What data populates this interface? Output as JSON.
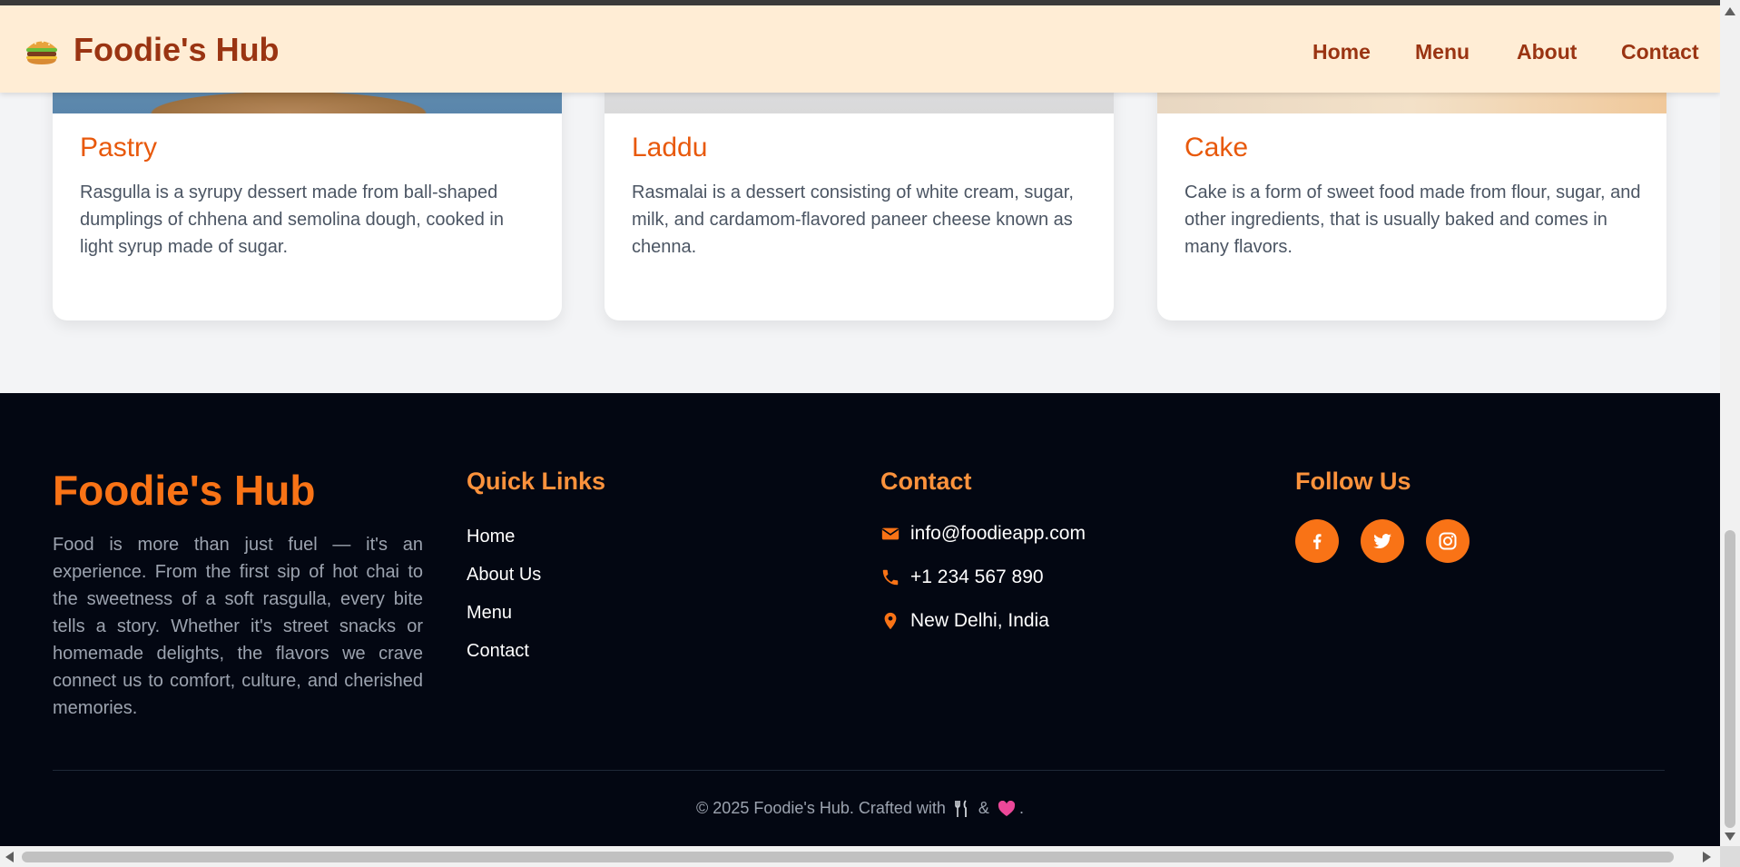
{
  "header": {
    "logo_icon": "burger-emoji-icon",
    "brand": "Foodie's Hub",
    "nav": [
      "Home",
      "Menu",
      "About",
      "Contact"
    ]
  },
  "cards": [
    {
      "title": "Pastry",
      "description": "Rasgulla is a syrupy dessert made from ball-shaped dumplings of chhena and semolina dough, cooked in light syrup made of sugar."
    },
    {
      "title": "Laddu",
      "description": "Rasmalai is a dessert consisting of white cream, sugar, milk, and cardamom-flavored paneer cheese known as chenna."
    },
    {
      "title": "Cake",
      "description": "Cake is a form of sweet food made from flour, sugar, and other ingredients, that is usually baked and comes in many flavors."
    }
  ],
  "footer": {
    "brand": "Foodie's Hub",
    "about": "Food is more than just fuel — it's an experience. From the first sip of hot chai to the sweetness of a soft rasgulla, every bite tells a story. Whether it's street snacks or homemade delights, the flavors we crave connect us to comfort, culture, and cherished memories.",
    "quick_links_heading": "Quick Links",
    "quick_links": [
      "Home",
      "About Us",
      "Menu",
      "Contact"
    ],
    "contact_heading": "Contact",
    "contact": {
      "email": "info@foodieapp.com",
      "phone": "+1 234 567 890",
      "location": "New Delhi, India"
    },
    "follow_heading": "Follow Us",
    "social": [
      "facebook-icon",
      "twitter-icon",
      "instagram-icon"
    ],
    "copyright_prefix": "© 2025 Foodie's Hub. Crafted with",
    "copyright_amp": "&",
    "copyright_suffix": "."
  },
  "colors": {
    "accent": "#f97316",
    "header_bg": "#ffedd5",
    "brand_text": "#9a3412",
    "footer_bg": "#030712",
    "card_title": "#e8590c"
  }
}
